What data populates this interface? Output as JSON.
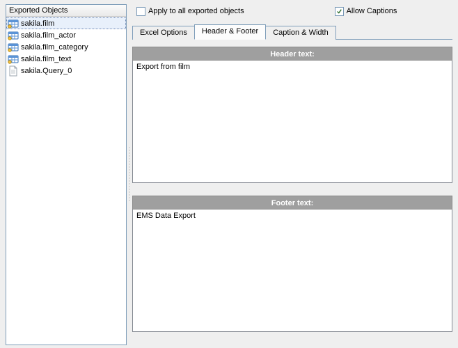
{
  "left": {
    "title": "Exported Objects",
    "items": [
      {
        "label": "sakila.film",
        "icon": "table",
        "selected": true
      },
      {
        "label": "sakila.film_actor",
        "icon": "table",
        "selected": false
      },
      {
        "label": "sakila.film_category",
        "icon": "table",
        "selected": false
      },
      {
        "label": "sakila.film_text",
        "icon": "table",
        "selected": false
      },
      {
        "label": "sakila.Query_0",
        "icon": "doc",
        "selected": false
      }
    ]
  },
  "checks": {
    "apply_all": {
      "label": "Apply to all exported objects",
      "checked": false
    },
    "allow_captions": {
      "label": "Allow Captions",
      "checked": true
    }
  },
  "tabs": {
    "excel": "Excel Options",
    "header_footer": "Header & Footer",
    "caption": "Caption & Width",
    "active": "header_footer"
  },
  "header_section": {
    "title": "Header text:",
    "value": "Export from film"
  },
  "footer_section": {
    "title": "Footer text:",
    "value": "EMS Data Export"
  }
}
